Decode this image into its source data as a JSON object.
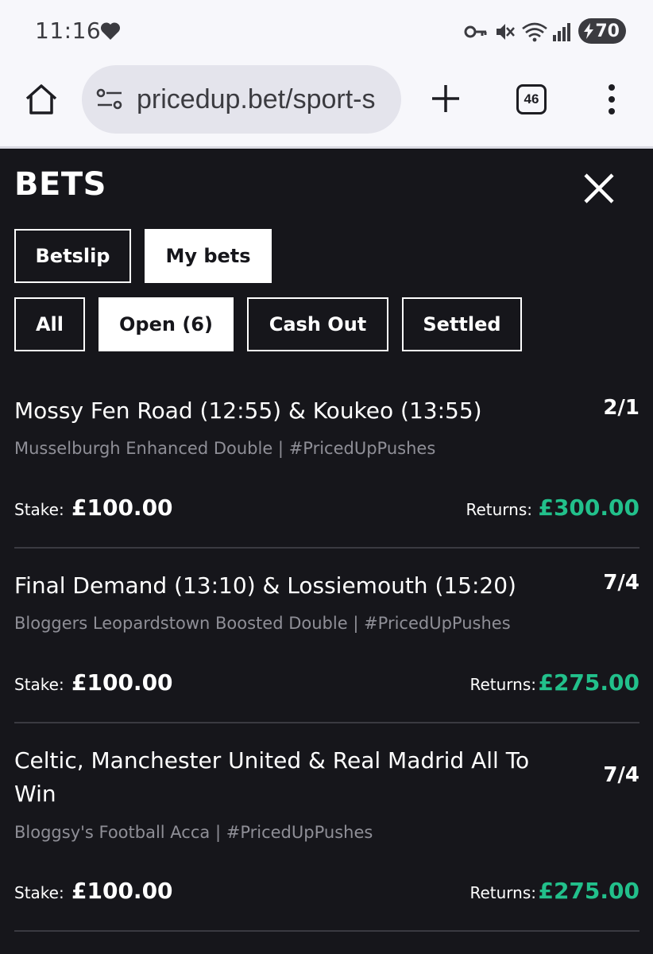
{
  "status_bar": {
    "time": "11:16",
    "battery": "70",
    "icons": [
      "heart-icon",
      "key-icon",
      "vibrate-icon",
      "wifi-icon",
      "signal-icon",
      "battery-charging-icon"
    ]
  },
  "browser": {
    "url": "pricedup.bet/sport-s",
    "tab_count": "46",
    "icons": [
      "home-icon",
      "site-settings-icon",
      "new-tab-plus-icon",
      "tabs-icon",
      "more-menu-icon"
    ]
  },
  "panel": {
    "title": "BETS",
    "tabs": [
      {
        "label": "Betslip",
        "active": false
      },
      {
        "label": "My bets",
        "active": true
      }
    ],
    "filters": [
      {
        "label": "All",
        "active": false
      },
      {
        "label": "Open (6)",
        "active": true
      },
      {
        "label": "Cash Out",
        "active": false
      },
      {
        "label": "Settled",
        "active": false
      }
    ],
    "stake_label": "Stake:",
    "returns_label": "Returns:",
    "bets": [
      {
        "title": "Mossy Fen Road (12:55) & Koukeo (13:55)",
        "odds": "2/1",
        "subtitle": "Musselburgh Enhanced Double",
        "tag": "#PricedUpPushes",
        "stake": "£100.00",
        "returns": "£300.00"
      },
      {
        "title": "Final Demand (13:10) & Lossiemouth (15:20)",
        "odds": "7/4",
        "subtitle": "Bloggers Leopardstown Boosted Double",
        "tag": "#PricedUpPushes",
        "stake": "£100.00",
        "returns": "£275.00"
      },
      {
        "title": "Celtic, Manchester United & Real Madrid All To Win",
        "odds": "7/4",
        "subtitle": "Bloggsy's Football Acca",
        "tag": "#PricedUpPushes",
        "stake": "£100.00",
        "returns": "£275.00"
      }
    ]
  },
  "colors": {
    "panel_bg": "#16161b",
    "returns_green": "#22c08b",
    "muted_text": "#8f8f97",
    "browser_bg": "#f7f7fb"
  }
}
